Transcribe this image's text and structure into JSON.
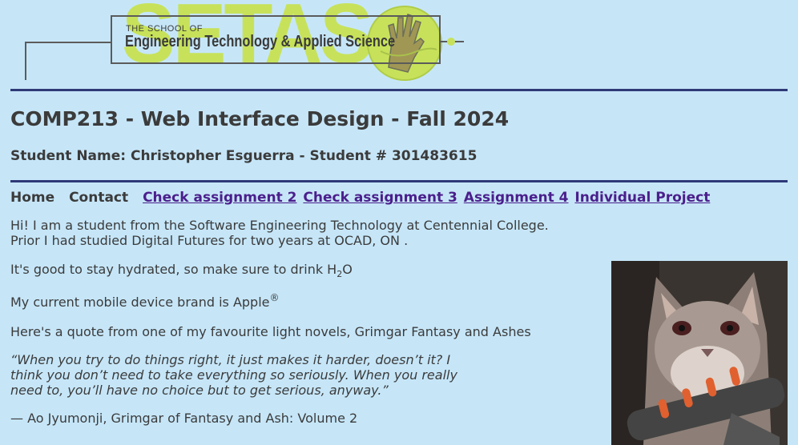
{
  "logo": {
    "big_text": "SETAS",
    "small_text": "THE SCHOOL OF",
    "main_text": "Engineering Technology & Applied Science"
  },
  "header": {
    "title": "COMP213 - Web Interface Design - Fall 2024",
    "student": "Student Name: Christopher Esguerra - Student # 301483615"
  },
  "nav": {
    "home": "Home",
    "contact": "Contact",
    "links": [
      "Check assignment 2",
      "Check assignment 3",
      "Assignment 4",
      "Individual Project"
    ]
  },
  "content": {
    "intro_line1": "Hi! I am a student from the Software Engineering Technology at Centennial College.",
    "intro_line2": "Prior I had studied Digital Futures for two years at OCAD, ON .",
    "h2o_text": "It's good to stay hydrated, so make sure to drink H",
    "h2o_sub": "2",
    "h2o_end": "O",
    "apple_text": "My current mobile device brand is Apple",
    "apple_sup": "®",
    "quote_intro": "Here's a quote from one of my favourite light novels, Grimgar Fantasy and Ashes",
    "quote": "“When you try to do things right, it just makes it harder, doesn’t it? I think you don’t need to take everything so seriously. When you really need to, you’ll have no choice but to get serious, anyway.”",
    "cite": "— Ao Jyumonji, Grimgar of Fantasy and Ash: Volume 2"
  },
  "colors": {
    "background": "#c6e6f8",
    "rule": "#2e3a78",
    "link": "#4b1f8c",
    "logo_accent": "#c7e25a"
  }
}
